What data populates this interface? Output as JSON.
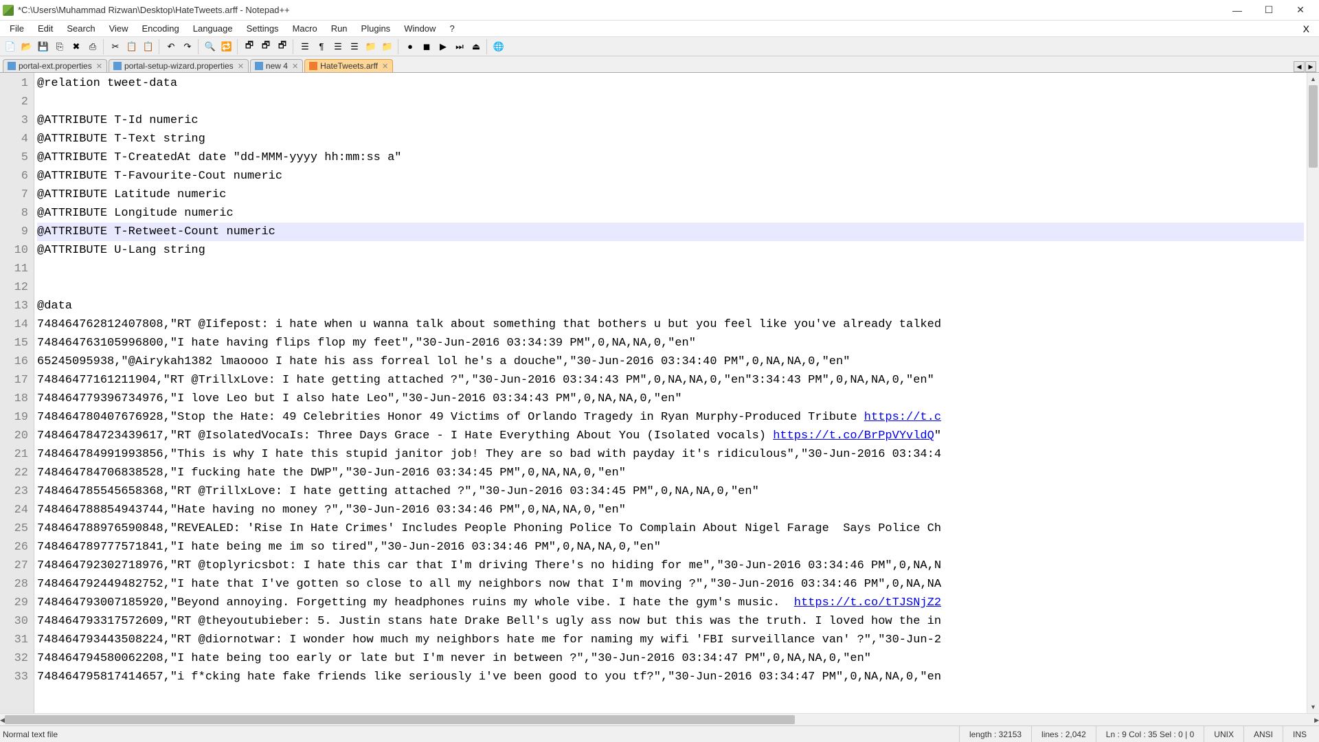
{
  "title": "*C:\\Users\\Muhammad Rizwan\\Desktop\\HateTweets.arff - Notepad++",
  "menu": [
    "File",
    "Edit",
    "Search",
    "View",
    "Encoding",
    "Language",
    "Settings",
    "Macro",
    "Run",
    "Plugins",
    "Window",
    "?"
  ],
  "toolbar_icons": [
    "📄",
    "📂",
    "💾",
    "⎘",
    "✖",
    "⎙",
    "|",
    "✂",
    "📋",
    "📋",
    "|",
    "↶",
    "↷",
    "|",
    "🔍",
    "🔁",
    "|",
    "🗗",
    "🗗",
    "🗗",
    "|",
    "☰",
    "¶",
    "☰",
    "☰",
    "📁",
    "📁",
    "|",
    "●",
    "◼",
    "▶",
    "⏭",
    "⏏",
    "|",
    "🌐"
  ],
  "tabs": [
    {
      "label": "portal-ext.properties",
      "active": false,
      "icon": "blue"
    },
    {
      "label": "portal-setup-wizard.properties",
      "active": false,
      "icon": "blue"
    },
    {
      "label": "new 4",
      "active": false,
      "icon": "blue"
    },
    {
      "label": "HateTweets.arff",
      "active": true,
      "icon": "orange"
    }
  ],
  "gutter_start": 1,
  "highlight_line": 9,
  "code_lines": [
    "@relation tweet-data",
    "",
    "@ATTRIBUTE T-Id numeric",
    "@ATTRIBUTE T-Text string",
    "@ATTRIBUTE T-CreatedAt date \"dd-MMM-yyyy hh:mm:ss a\"",
    "@ATTRIBUTE T-Favourite-Cout numeric",
    "@ATTRIBUTE Latitude numeric",
    "@ATTRIBUTE Longitude numeric",
    "@ATTRIBUTE T-Retweet-Count numeric",
    "@ATTRIBUTE U-Lang string",
    "",
    "",
    "@data",
    "748464762812407808,\"RT @Iifepost: i hate when u wanna talk about something that bothers u but you feel like you've already talked",
    "748464763105996800,\"I hate having flips flop my feet\",\"30-Jun-2016 03:34:39 PM\",0,NA,NA,0,\"en\"",
    "65245095938,\"@Airykah1382 lmaoooo I hate his ass forreal lol he's a douche\",\"30-Jun-2016 03:34:40 PM\",0,NA,NA,0,\"en\"",
    "74846477161211904,\"RT @TrillxLove: I hate getting attached ?\",\"30-Jun-2016 03:34:43 PM\",0,NA,NA,0,\"en\"3:34:43 PM\",0,NA,NA,0,\"en\"",
    "748464779396734976,\"I love Leo but I also hate Leo\",\"30-Jun-2016 03:34:43 PM\",0,NA,NA,0,\"en\"",
    "748464780407676928,\"Stop the Hate: 49 Celebrities Honor 49 Victims of Orlando Tragedy in Ryan Murphy-Produced Tribute <a>https://t.c</a>",
    "748464784723439617,\"RT @IsolatedVocaIs: Three Days Grace - I Hate Everything About You (Isolated vocals) <a>https://t.co/BrPpVYvldQ</a>\"",
    "748464784991993856,\"This is why I hate this stupid janitor job! They are so bad with payday it's ridiculous\",\"30-Jun-2016 03:34:4",
    "748464784706838528,\"I fucking hate the DWP\",\"30-Jun-2016 03:34:45 PM\",0,NA,NA,0,\"en\"",
    "748464785545658368,\"RT @TrillxLove: I hate getting attached ?\",\"30-Jun-2016 03:34:45 PM\",0,NA,NA,0,\"en\"",
    "748464788854943744,\"Hate having no money ?\",\"30-Jun-2016 03:34:46 PM\",0,NA,NA,0,\"en\"",
    "748464788976590848,\"REVEALED: 'Rise In Hate Crimes' Includes People Phoning Police To Complain About Nigel Farage  Says Police Ch",
    "748464789777571841,\"I hate being me im so tired\",\"30-Jun-2016 03:34:46 PM\",0,NA,NA,0,\"en\"",
    "748464792302718976,\"RT @toplyricsbot: I hate this car that I'm driving There's no hiding for me\",\"30-Jun-2016 03:34:46 PM\",0,NA,N",
    "748464792449482752,\"I hate that I've gotten so close to all my neighbors now that I'm moving ?\",\"30-Jun-2016 03:34:46 PM\",0,NA,NA",
    "748464793007185920,\"Beyond annoying. Forgetting my headphones ruins my whole vibe. I hate the gym's music.  <a>https://t.co/tTJSNjZ2</a>",
    "748464793317572609,\"RT @theyoutubieber: 5. Justin stans hate Drake Bell's ugly ass now but this was the truth. I loved how the in",
    "748464793443508224,\"RT @diornotwar: I wonder how much my neighbors hate me for naming my wifi 'FBI surveillance van' ?\",\"30-Jun-2",
    "748464794580062208,\"I hate being too early or late but I'm never in between ?\",\"30-Jun-2016 03:34:47 PM\",0,NA,NA,0,\"en\"",
    "748464795817414657,\"i f*cking hate fake friends like seriously i've been good to you tf?\",\"30-Jun-2016 03:34:47 PM\",0,NA,NA,0,\"en"
  ],
  "status": {
    "left": "Normal text file",
    "length": "length : 32153",
    "lines": "lines : 2,042",
    "pos": "Ln : 9    Col : 35    Sel : 0 | 0",
    "eol": "UNIX",
    "enc": "ANSI",
    "mode": "INS"
  }
}
